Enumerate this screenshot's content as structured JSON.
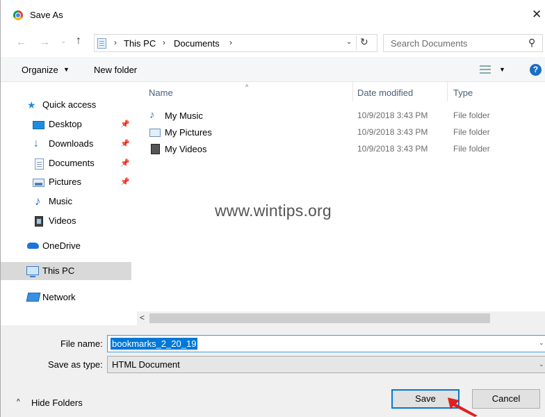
{
  "window": {
    "title": "Save As",
    "close_glyph": "✕",
    "icon": "chrome-icon"
  },
  "address": {
    "back_glyph": "←",
    "forward_glyph": "→",
    "recent_glyph": "⌄",
    "up_glyph": "↑",
    "crumbs": [
      "This PC",
      "Documents"
    ],
    "separator": "›",
    "dropdown_glyph": "⌄",
    "refresh_glyph": "↻"
  },
  "search": {
    "placeholder": "Search Documents",
    "icon_glyph": "⚲"
  },
  "toolbar": {
    "organize_label": "Organize",
    "caret": "▼",
    "new_folder_label": "New folder",
    "view_caret": "▼",
    "help_glyph": "?"
  },
  "navigation": {
    "pin_glyph": "📌",
    "quick_access": "Quick access",
    "items": [
      {
        "label": "Desktop",
        "icon": "desktop-icon",
        "pinned": true
      },
      {
        "label": "Downloads",
        "icon": "downloads-icon",
        "pinned": true
      },
      {
        "label": "Documents",
        "icon": "documents-icon",
        "pinned": true
      },
      {
        "label": "Pictures",
        "icon": "pictures-icon",
        "pinned": true
      },
      {
        "label": "Music",
        "icon": "music-icon",
        "pinned": false
      },
      {
        "label": "Videos",
        "icon": "videos-icon",
        "pinned": false
      }
    ],
    "onedrive": "OneDrive",
    "this_pc": "This PC",
    "network": "Network",
    "selected": "This PC"
  },
  "filelist": {
    "columns": {
      "name": "Name",
      "date": "Date modified",
      "type": "Type"
    },
    "sort_glyph": "^",
    "rows": [
      {
        "name": "My Music",
        "date": "10/9/2018 3:43 PM",
        "type": "File folder",
        "icon": "music-folder-icon"
      },
      {
        "name": "My Pictures",
        "date": "10/9/2018 3:43 PM",
        "type": "File folder",
        "icon": "pictures-folder-icon"
      },
      {
        "name": "My Videos",
        "date": "10/9/2018 3:43 PM",
        "type": "File folder",
        "icon": "videos-folder-icon"
      }
    ],
    "watermark": "www.wintips.org"
  },
  "scrollbar": {
    "left_glyph": "<"
  },
  "form": {
    "file_name_label": "File name:",
    "file_name_value": "bookmarks_2_20_19",
    "save_as_type_label": "Save as type:",
    "save_as_type_value": "HTML Document",
    "caret": "⌄"
  },
  "footer": {
    "hide_folders_label": "Hide Folders",
    "hide_glyph": "^",
    "save_label": "Save",
    "cancel_label": "Cancel"
  },
  "colors": {
    "accent": "#0078d7",
    "selection_bg": "#d9d9d9",
    "arrow": "#e02020"
  }
}
